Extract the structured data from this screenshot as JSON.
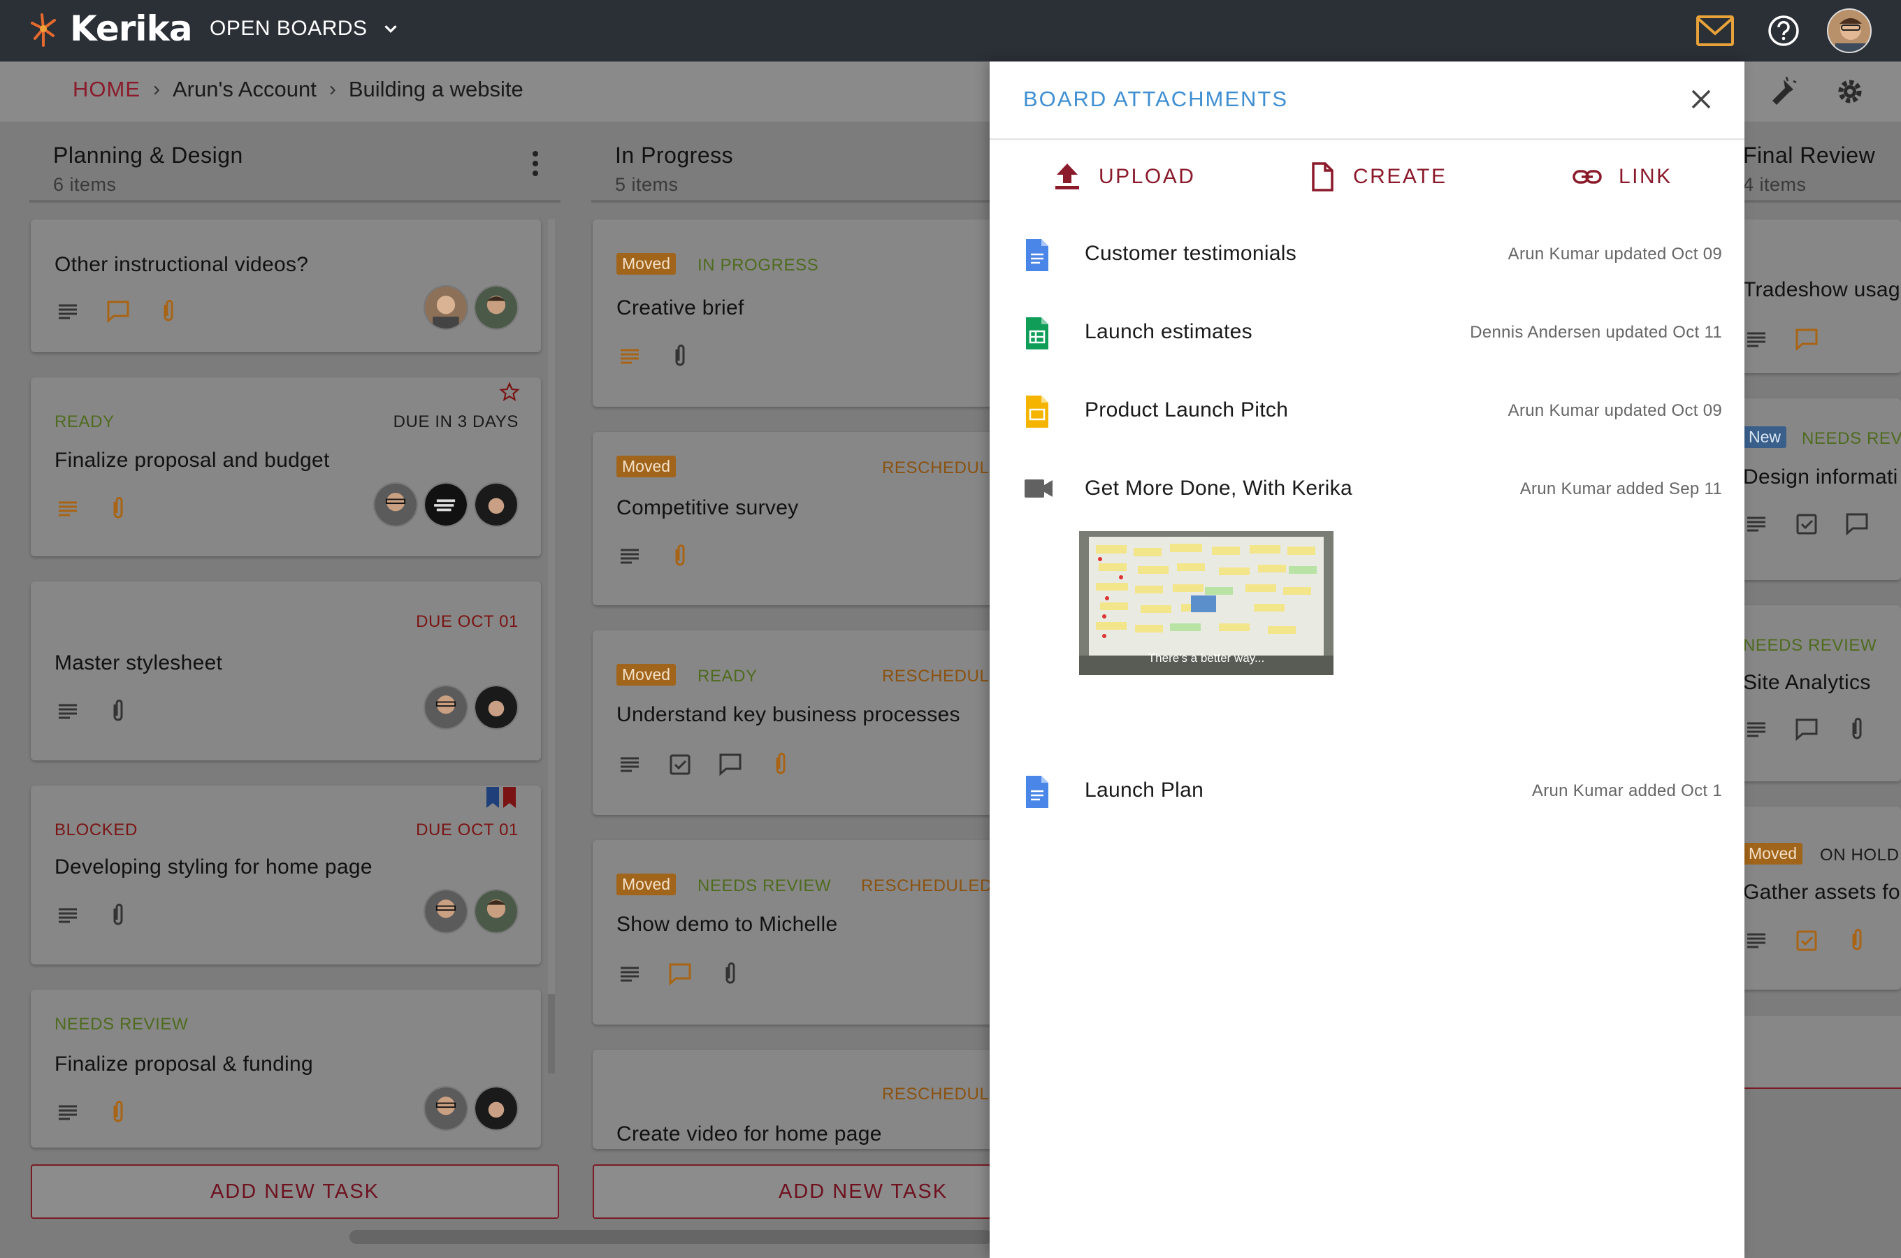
{
  "app": {
    "name": "Kerika"
  },
  "topbar": {
    "open_boards_label": "OPEN BOARDS"
  },
  "breadcrumb": {
    "home": "HOME",
    "account": "Arun's Account",
    "board": "Building a website"
  },
  "colors": {
    "accent": "#8b1a2b",
    "panel_title": "#3f8fd2",
    "topbar": "#2b2f36",
    "mail_icon": "#e8a23a"
  },
  "columns": [
    {
      "title": "Planning & Design",
      "count": "6 items",
      "add_task": "ADD NEW TASK",
      "cards": [
        {
          "title": "Other instructional videos?",
          "status": "",
          "due": ""
        },
        {
          "title": "Finalize proposal and budget",
          "status": "READY",
          "due": "DUE IN 3 DAYS"
        },
        {
          "title": "Master stylesheet",
          "status": "",
          "due": "DUE OCT 01"
        },
        {
          "title": "Developing styling for home page",
          "status": "BLOCKED",
          "due": "DUE OCT 01"
        },
        {
          "title": "Finalize proposal & funding",
          "status": "NEEDS REVIEW",
          "due": ""
        }
      ]
    },
    {
      "title": "In Progress",
      "count": "5 items",
      "add_task": "ADD NEW TASK",
      "cards": [
        {
          "tag": "Moved",
          "title": "Creative brief",
          "status": "IN PROGRESS",
          "due": ""
        },
        {
          "tag": "Moved",
          "title": "Competitive survey",
          "status": "",
          "due": "RESCHEDULE"
        },
        {
          "tag": "Moved",
          "title": "Understand key business processes",
          "status": "READY",
          "due": "RESCHEDULE"
        },
        {
          "tag": "Moved",
          "title": "Show demo to Michelle",
          "status": "NEEDS REVIEW",
          "due": "RESCHEDULED T"
        },
        {
          "title": "Create video for home page",
          "status": "",
          "due": "RESCHEDULE"
        }
      ]
    },
    {
      "title": "Final Review",
      "count": "4 items",
      "cards": [
        {
          "title": "Tradeshow usag",
          "status": "",
          "due": ""
        },
        {
          "tag": "New",
          "title": "Design informati",
          "status": "NEEDS REVI",
          "due": ""
        },
        {
          "title": "Site Analytics",
          "status": "NEEDS REVIEW",
          "due": ""
        },
        {
          "tag": "Moved",
          "title": "Gather assets fo",
          "status": "ON HOLD",
          "due": ""
        }
      ]
    }
  ],
  "panel": {
    "title": "BOARD ATTACHMENTS",
    "actions": {
      "upload": "UPLOAD",
      "create": "CREATE",
      "link": "LINK"
    },
    "attachments": [
      {
        "name": "Customer testimonials",
        "meta": "Arun Kumar updated Oct 09",
        "icon": "google-doc-icon"
      },
      {
        "name": "Launch estimates",
        "meta": "Dennis Andersen updated Oct 11",
        "icon": "google-sheet-icon"
      },
      {
        "name": "Product Launch Pitch",
        "meta": "Arun Kumar updated Oct 09",
        "icon": "google-slides-icon"
      },
      {
        "name": "Get More Done, With Kerika",
        "meta": "Arun Kumar added Sep 11",
        "icon": "video-icon",
        "thumbnail_caption": "There's a better way..."
      },
      {
        "name": "Launch Plan",
        "meta": "Arun Kumar added Oct 1",
        "icon": "google-doc-icon"
      }
    ]
  }
}
